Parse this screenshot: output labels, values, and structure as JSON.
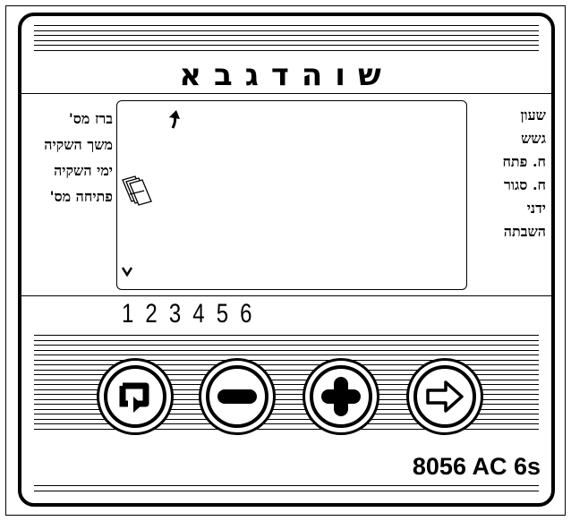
{
  "device": {
    "title": "שוהדגבא",
    "model": "8056 AC 6s"
  },
  "left_labels": [
    "ברז מס'",
    "משך השקיה",
    "ימי השקיה",
    "פתיחה מס'"
  ],
  "right_labels": [
    "שעון",
    "גשש",
    "ח. פתח",
    "ח. סגור",
    "ידני",
    "השבתה"
  ],
  "valves": [
    "1",
    "2",
    "3",
    "4",
    "5",
    "6"
  ],
  "buttons": [
    {
      "name": "cycle-button",
      "icon": "cycle-icon"
    },
    {
      "name": "minus-button",
      "icon": "minus-icon"
    },
    {
      "name": "plus-button",
      "icon": "plus-icon"
    },
    {
      "name": "next-button",
      "icon": "arrow-right-icon"
    }
  ],
  "display": {
    "up_indicator": "↑",
    "down_indicator": "˅"
  }
}
